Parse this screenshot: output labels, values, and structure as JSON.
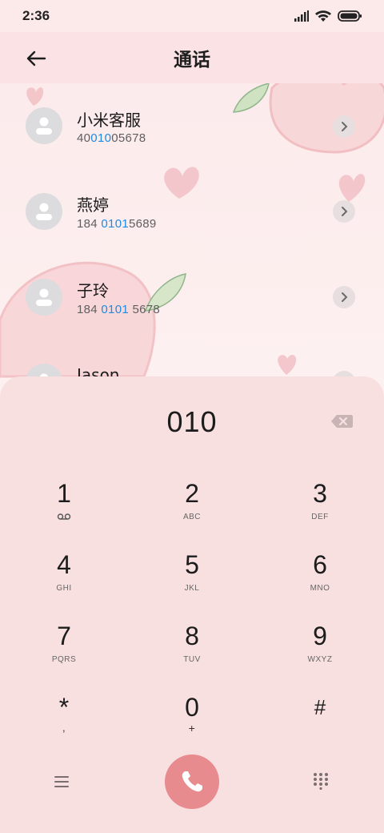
{
  "status_bar": {
    "time": "2:36"
  },
  "header": {
    "title": "通话"
  },
  "contacts": [
    {
      "name": "小米客服",
      "num_pre": "40",
      "num_hl": "010",
      "num_post": "05678"
    },
    {
      "name": "燕婷",
      "num_pre": "184 ",
      "num_hl": "0101",
      "num_post": "5689"
    },
    {
      "name": "子玲",
      "num_pre": "184 ",
      "num_hl": "0101",
      "num_post": " 5678"
    },
    {
      "name": "Jason",
      "num_pre": "",
      "num_hl": "",
      "num_post": ""
    }
  ],
  "dialer": {
    "display": "010",
    "keys": [
      {
        "digit": "1",
        "letters": ""
      },
      {
        "digit": "2",
        "letters": "ABC"
      },
      {
        "digit": "3",
        "letters": "DEF"
      },
      {
        "digit": "4",
        "letters": "GHI"
      },
      {
        "digit": "5",
        "letters": "JKL"
      },
      {
        "digit": "6",
        "letters": "MNO"
      },
      {
        "digit": "7",
        "letters": "PQRS"
      },
      {
        "digit": "8",
        "letters": "TUV"
      },
      {
        "digit": "9",
        "letters": "WXYZ"
      },
      {
        "digit": "*",
        "letters": ","
      },
      {
        "digit": "0",
        "letters": "+"
      },
      {
        "digit": "#",
        "letters": ""
      }
    ]
  },
  "icons": {
    "back": "arrow-left-icon",
    "voicemail": "voicemail-icon",
    "backspace": "backspace-icon",
    "call": "phone-icon",
    "menu": "menu-icon",
    "keypad": "keypad-icon"
  },
  "colors": {
    "accent": "#1f8ae0",
    "call": "#e88b8f",
    "panel": "#f8dfe0"
  }
}
